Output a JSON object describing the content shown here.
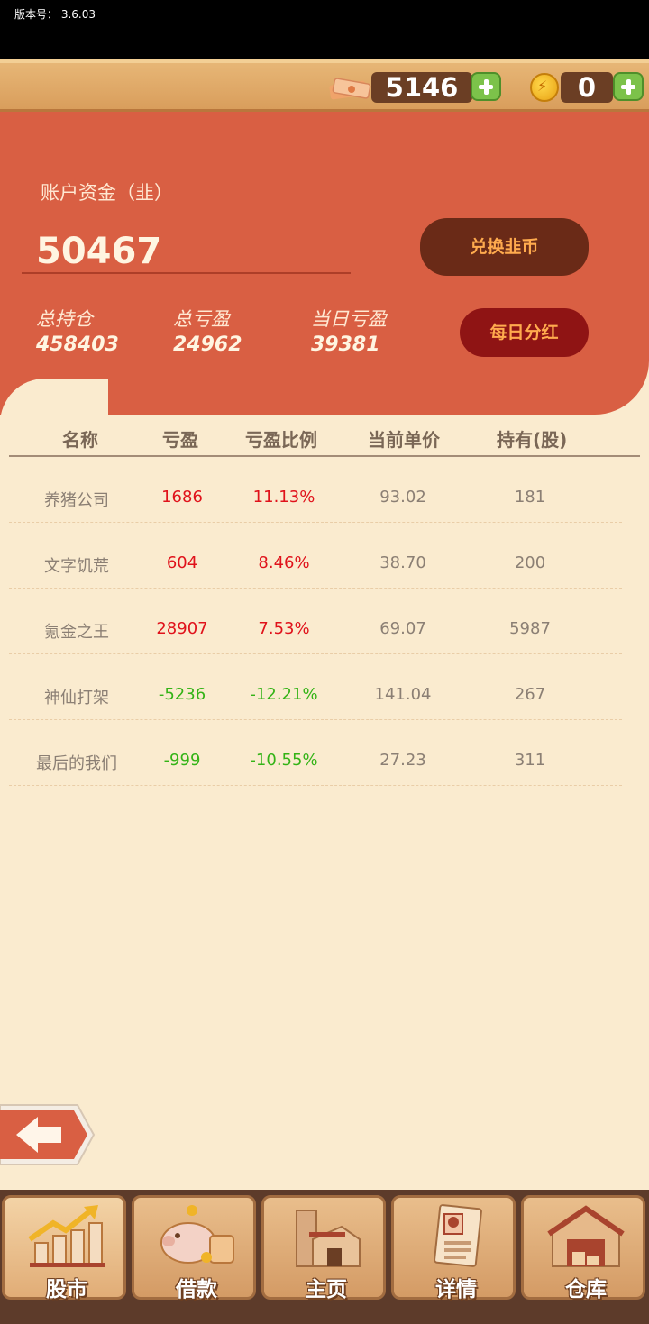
{
  "version": {
    "label": "版本号：  3.6.03"
  },
  "top_bar": {
    "cash_value": "5146",
    "coin_value": "0"
  },
  "account": {
    "label": "账户资金（韭）",
    "value": "50467",
    "exchange_button": "兑换韭币",
    "dividend_button": "每日分红",
    "stats": [
      {
        "label": "总持仓",
        "value": "458403"
      },
      {
        "label": "总亏盈",
        "value": "24962"
      },
      {
        "label": "当日亏盈",
        "value": "39381"
      }
    ]
  },
  "table": {
    "headers": [
      "名称",
      "亏盈",
      "亏盈比例",
      "当前单价",
      "持有(股)"
    ],
    "rows": [
      {
        "name": "养猪公司",
        "pnl": "1686",
        "ratio": "11.13%",
        "price": "93.02",
        "shares": "181",
        "trend": "up"
      },
      {
        "name": "文字饥荒",
        "pnl": "604",
        "ratio": "8.46%",
        "price": "38.70",
        "shares": "200",
        "trend": "up"
      },
      {
        "name": "氪金之王",
        "pnl": "28907",
        "ratio": "7.53%",
        "price": "69.07",
        "shares": "5987",
        "trend": "up"
      },
      {
        "name": "神仙打架",
        "pnl": "-5236",
        "ratio": "-12.21%",
        "price": "141.04",
        "shares": "267",
        "trend": "down"
      },
      {
        "name": "最后的我们",
        "pnl": "-999",
        "ratio": "-10.55%",
        "price": "27.23",
        "shares": "311",
        "trend": "down"
      }
    ]
  },
  "colors": {
    "up": "#e0121b",
    "down": "#33b316",
    "neutral": "#8b7f74"
  },
  "nav": [
    {
      "label": "股市",
      "icon": "stock-chart-icon"
    },
    {
      "label": "借款",
      "icon": "piggy-bank-icon"
    },
    {
      "label": "主页",
      "icon": "house-icon"
    },
    {
      "label": "详情",
      "icon": "profile-doc-icon"
    },
    {
      "label": "仓库",
      "icon": "warehouse-icon"
    }
  ]
}
